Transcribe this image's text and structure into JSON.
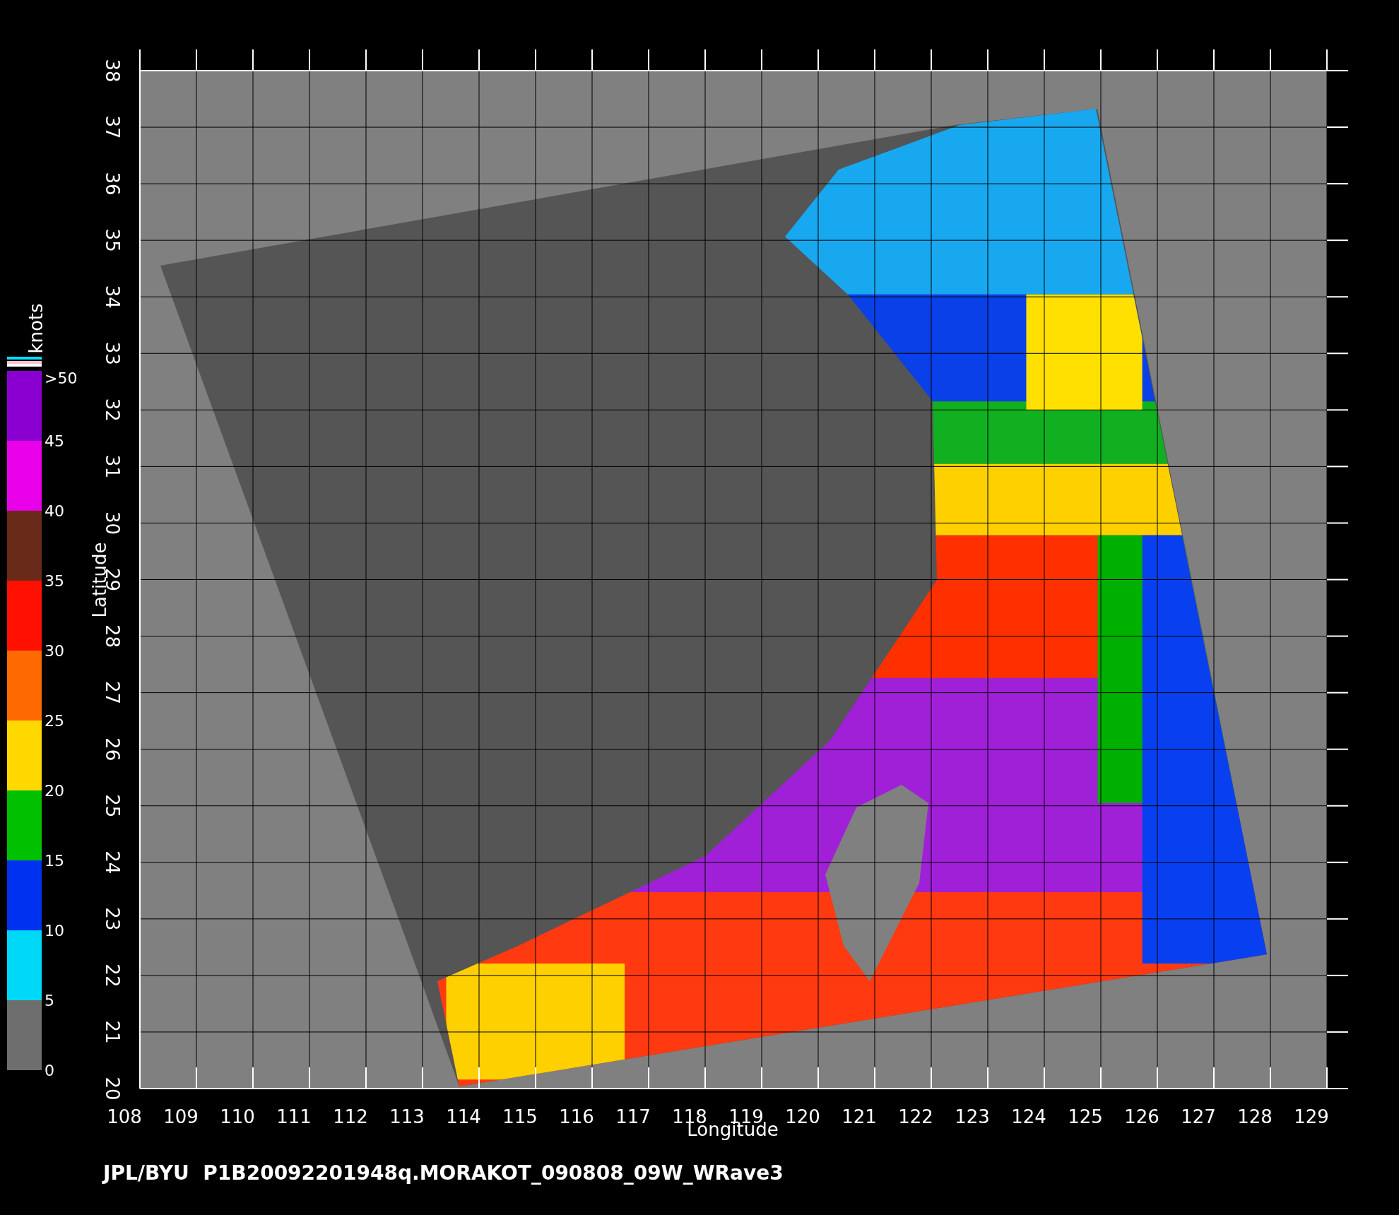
{
  "map": {
    "xlabel": "Longitude",
    "ylabel": "Latitude",
    "xticks": [
      "108",
      "109",
      "110",
      "111",
      "112",
      "113",
      "114",
      "115",
      "116",
      "117",
      "118",
      "119",
      "120",
      "121",
      "122",
      "123",
      "124",
      "125",
      "126",
      "127",
      "128",
      "129"
    ],
    "yticks": [
      "20",
      "21",
      "22",
      "23",
      "24",
      "25",
      "26",
      "27",
      "28",
      "29",
      "30",
      "31",
      "32",
      "33",
      "34",
      "35",
      "36",
      "37",
      "38"
    ]
  },
  "colorbar": {
    "title": "knots",
    "top_label": ">50",
    "bands": [
      {
        "label": "45",
        "color": "#8a00d0"
      },
      {
        "label": "40",
        "color": "#e800e8"
      },
      {
        "label": "35",
        "color": "#6a2a1a"
      },
      {
        "label": "30",
        "color": "#ff1000"
      },
      {
        "label": "25",
        "color": "#ff6a00"
      },
      {
        "label": "20",
        "color": "#ffd800"
      },
      {
        "label": "15",
        "color": "#00c000"
      },
      {
        "label": "10",
        "color": "#0030f0"
      },
      {
        "label": "5",
        "color": "#00d8f8"
      },
      {
        "label": "0",
        "color": "#6e6e6e"
      }
    ]
  },
  "footer": "JPL/BYU  P1B20092201948q.MORAKOT_090808_09W_WRave3"
}
